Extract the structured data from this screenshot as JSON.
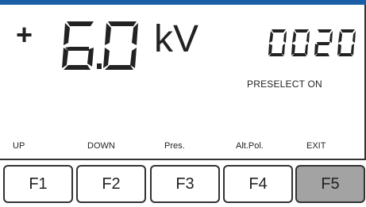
{
  "display": {
    "polarity": "+",
    "voltage_value": "6.0",
    "voltage_unit": "kV",
    "counter": "0020",
    "status": "PRESELECT ON"
  },
  "softkeys": {
    "labels": [
      "UP",
      "DOWN",
      "Pres.",
      "Alt.Pol.",
      "EXIT"
    ]
  },
  "function_keys": [
    {
      "label": "F1",
      "active": false
    },
    {
      "label": "F2",
      "active": false
    },
    {
      "label": "F3",
      "active": false
    },
    {
      "label": "F4",
      "active": false
    },
    {
      "label": "F5",
      "active": true
    }
  ],
  "colors": {
    "top_bar": "#1b5ea8",
    "lcd_background": "#ffffff",
    "text": "#222222",
    "active_key": "#a3a3a3"
  }
}
